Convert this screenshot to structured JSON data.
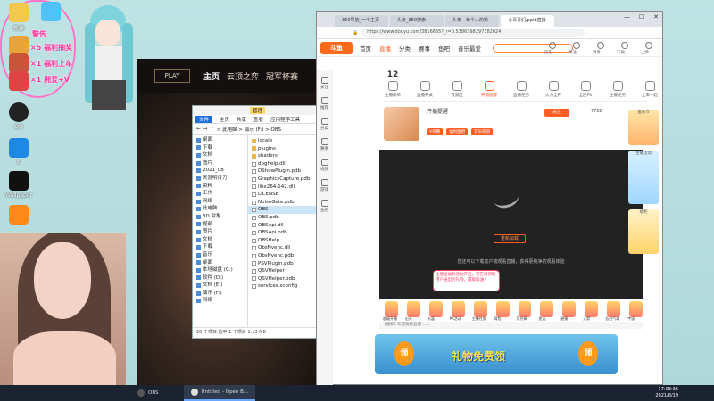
{
  "desktop": {
    "icons": [
      {
        "label": "新建"
      },
      {
        "label": ""
      },
      {
        "label": ""
      },
      {
        "label": ""
      },
      {
        "label": "QQ"
      },
      {
        "label": "K"
      },
      {
        "label": "Wallpaper"
      },
      {
        "label": ""
      }
    ],
    "overlay_texts": [
      "警告",
      "×5 福利抽奖",
      "×1 福利上车",
      "×1 拥爱+V"
    ]
  },
  "game": {
    "play": "PLAY",
    "nav": [
      "主页",
      "云顶之弈",
      "冠军杯赛"
    ]
  },
  "explorer": {
    "title_tab": "管理",
    "ribbon": [
      "文件",
      "主页",
      "共享",
      "查看",
      "应用程序工具"
    ],
    "breadcrumb": "> 此电脑 > 演示 (F:) > OBS",
    "nav_items": [
      "桌面",
      "下载",
      "文档",
      "图片",
      "2021_08",
      "天涯明月刀",
      "资料",
      "工作",
      "网络",
      "此电脑",
      "3D 对象",
      "视频",
      "图片",
      "文档",
      "下载",
      "音乐",
      "桌面",
      "本地磁盘 (C:)",
      "软件 (D:)",
      "文档 (E:)",
      "演示 (F:)",
      "网络"
    ],
    "files": [
      "locale",
      "plugins",
      "shaders",
      "dbghelp.dll",
      "DShowPlugin.pdb",
      "GraphicsCapture.pdb",
      "libx264-142.dll",
      "LICENSE",
      "NoiseGate.pdb",
      "OBS",
      "OBS.pdb",
      "OBSApi.dll",
      "OBSApi.pdb",
      "OBSHelp",
      "ObsNvenc.dll",
      "ObsNvenc.pdb",
      "PSVPlugin.pdb",
      "QSVHelper",
      "QSVHelper.pdb",
      "services.xconfig"
    ],
    "status": "20 个项目   选中 1 个项目 1.13 MB"
  },
  "browser": {
    "tabs": [
      "360导航_一个主页",
      "头条_360搜索",
      "头条 - 每个人的新",
      "小哥哥们/ppid直播"
    ],
    "url": "https://www.douyu.com/3816665?_r=0.5386398297382024",
    "logo": "斗鱼",
    "site_nav": [
      "首页",
      "直播",
      "分类",
      "赛事",
      "鱼吧",
      "音乐最爱"
    ],
    "right_nav": [
      "历史",
      "关注",
      "消息",
      "下载",
      "上传"
    ],
    "left_bar": [
      "关注",
      "推荐",
      "分类",
      "赛事",
      "视频",
      "游戏",
      "鱼吧"
    ],
    "categories": [
      {
        "label": "主播榜单",
        "badge": "12"
      },
      {
        "label": "直播开关",
        "badge": ""
      },
      {
        "label": "音频区",
        "badge": ""
      },
      {
        "label": "开播提醒",
        "badge": ""
      },
      {
        "label": "直播任务",
        "badge": ""
      },
      {
        "label": "火力全开",
        "badge": ""
      },
      {
        "label": "全民PK",
        "badge": ""
      },
      {
        "label": "主播任务",
        "badge": ""
      },
      {
        "label": "上车一起",
        "badge": ""
      }
    ],
    "room_title": "开播提醒",
    "tags": [
      "V领赛",
      "福利鱼吧",
      "音乐频道"
    ],
    "follow": "关注",
    "follow_count": "7788",
    "player_button": "重新加载",
    "player_msg": "您还可以下载客户端观看直播，获得更纯净的观看体验",
    "popup": "主播送福利活动开启，可在线领取用户送出的礼物，赢取加油！",
    "gifts": [
      "超级开播",
      "出火",
      "水晶",
      "PK活动",
      "主播任务",
      "背包",
      "荧光棒",
      "鱼丸",
      "甜蜜",
      "火箭",
      "告白气球",
      "宇宙"
    ],
    "chat": "[通知] 欢迎观看直播 ……",
    "banner_text": "礼物免费领",
    "banner_coin": "领",
    "right_col": [
      "鱼乐节",
      "主播活动",
      "福利"
    ]
  },
  "taskbar": {
    "items": [
      "OBS",
      "Untitled - Open B..."
    ],
    "time": "17:08:36",
    "date": "2021/8/19"
  }
}
